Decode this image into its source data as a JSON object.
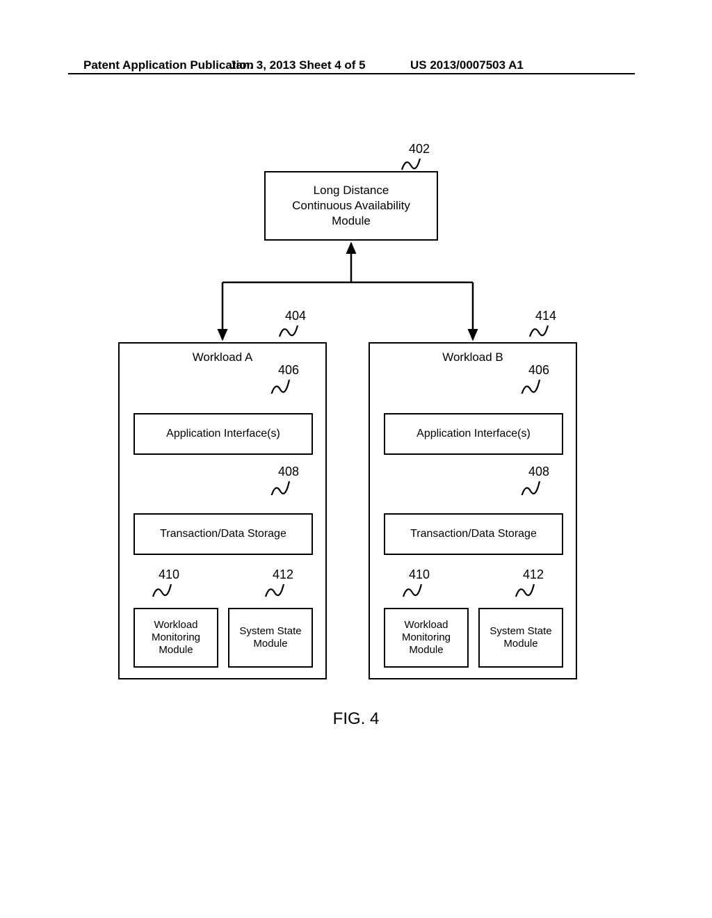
{
  "header": {
    "left": "Patent Application Publication",
    "mid": "Jan. 3, 2013   Sheet 4 of 5",
    "right": "US 2013/0007503 A1"
  },
  "top_module": {
    "line1": "Long Distance",
    "line2": "Continuous Availability",
    "line3": "Module",
    "ref": "402"
  },
  "workload_a": {
    "title": "Workload A",
    "ref": "404",
    "app_interfaces": {
      "label": "Application Interface(s)",
      "ref": "406"
    },
    "trans_storage": {
      "label": "Transaction/Data Storage",
      "ref": "408"
    },
    "monitor": {
      "label": "Workload Monitoring Module",
      "ref": "410"
    },
    "state": {
      "label": "System State Module",
      "ref": "412"
    }
  },
  "workload_b": {
    "title": "Workload B",
    "ref": "414",
    "app_interfaces": {
      "label": "Application Interface(s)",
      "ref": "406"
    },
    "trans_storage": {
      "label": "Transaction/Data Storage",
      "ref": "408"
    },
    "monitor": {
      "label": "Workload Monitoring Module",
      "ref": "410"
    },
    "state": {
      "label": "System State Module",
      "ref": "412"
    }
  },
  "figure_label": "FIG. 4"
}
